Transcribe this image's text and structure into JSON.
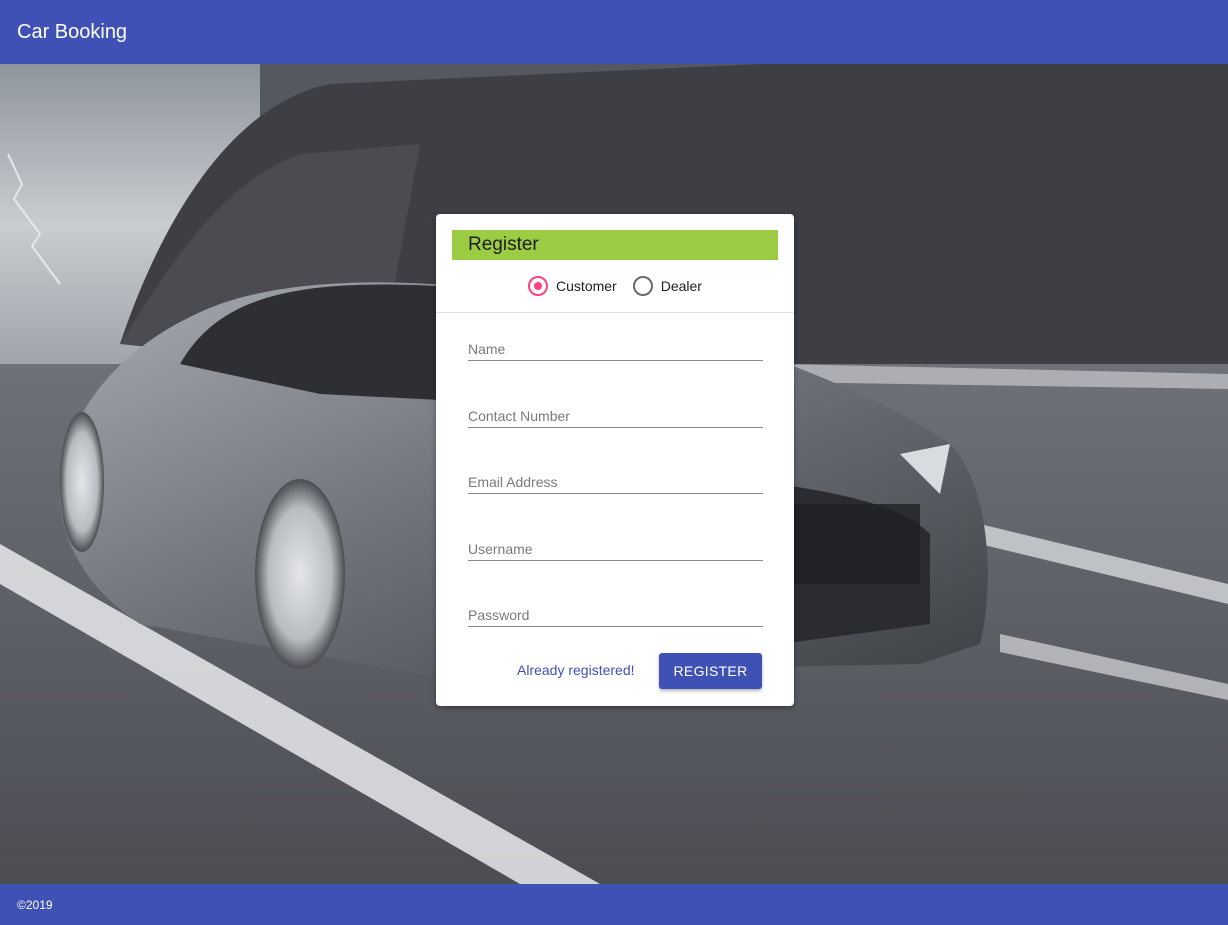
{
  "header": {
    "title": "Car Booking"
  },
  "form": {
    "title": "Register",
    "role": {
      "options": [
        {
          "label": "Customer",
          "checked": true
        },
        {
          "label": "Dealer",
          "checked": false
        }
      ]
    },
    "fields": {
      "name": {
        "placeholder": "Name",
        "value": ""
      },
      "contact": {
        "placeholder": "Contact Number",
        "value": ""
      },
      "email": {
        "placeholder": "Email Address",
        "value": ""
      },
      "username": {
        "placeholder": "Username",
        "value": ""
      },
      "password": {
        "placeholder": "Password",
        "value": ""
      }
    },
    "login_link": "Already registered!",
    "submit_label": "REGISTER"
  },
  "footer": {
    "copyright": "©2019"
  },
  "colors": {
    "primary": "#3f51b5",
    "header_accent": "#9ccc44",
    "radio_accent": "#ff4081"
  }
}
